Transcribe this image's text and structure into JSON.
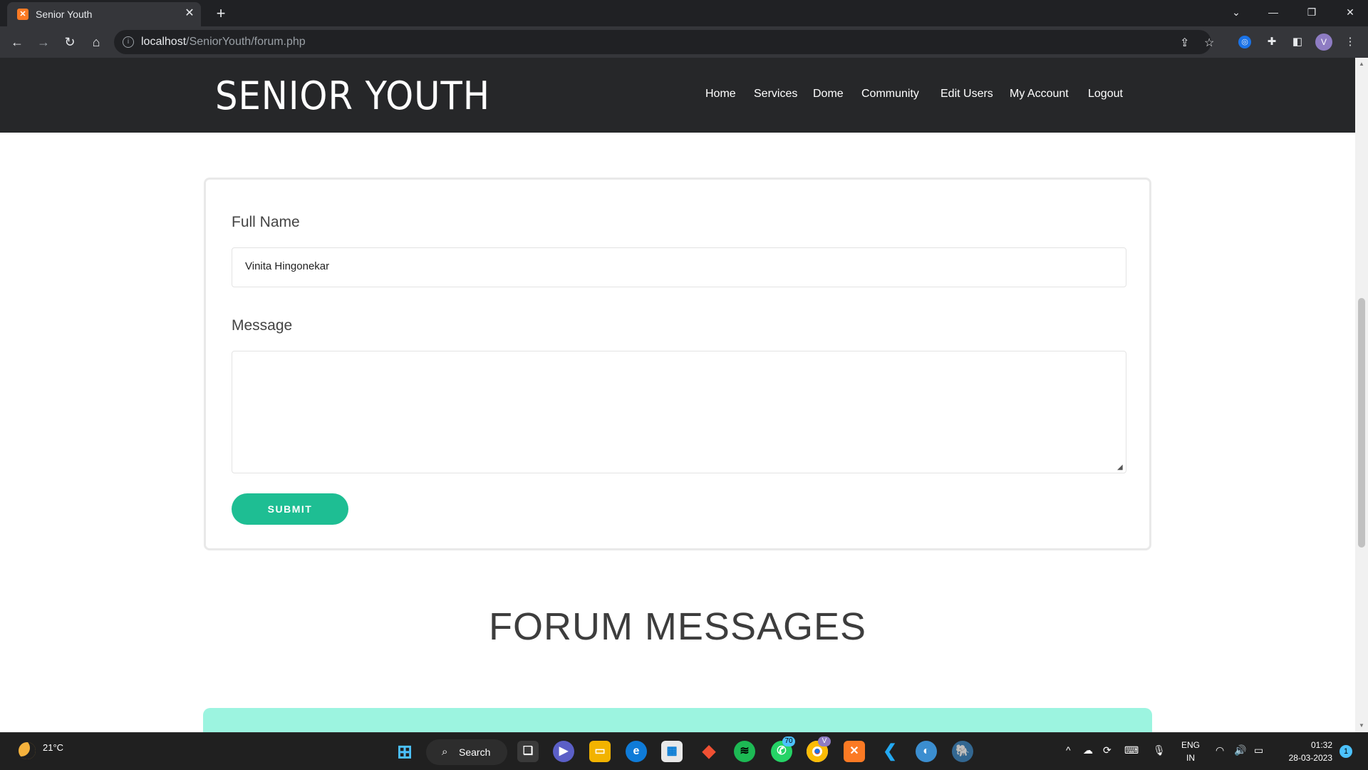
{
  "browser": {
    "tab_title": "Senior Youth",
    "url_host": "localhost",
    "url_path": "/SeniorYouth/forum.php",
    "avatar_initial": "V"
  },
  "site": {
    "logo": "SENIOR YOUTH",
    "nav": [
      "Home",
      "Services",
      "Dome",
      "Community",
      "Edit Users",
      "My Account",
      "Logout"
    ]
  },
  "form": {
    "name_label": "Full Name",
    "name_value": "Vinita Hingonekar",
    "message_label": "Message",
    "message_value": "",
    "submit_label": "SUBMIT"
  },
  "forum": {
    "title": "FORUM MESSAGES"
  },
  "taskbar": {
    "temperature": "21°C",
    "search_label": "Search",
    "whatsapp_badge": "70",
    "chrome_badge": "V",
    "lang_top": "ENG",
    "lang_bottom": "IN",
    "time": "01:32",
    "date": "28-03-2023",
    "notification_count": "1"
  },
  "colors": {
    "header_bg": "#262729",
    "submit_bg": "#1ebe93",
    "forum_box_bg": "#9cf4e0"
  }
}
